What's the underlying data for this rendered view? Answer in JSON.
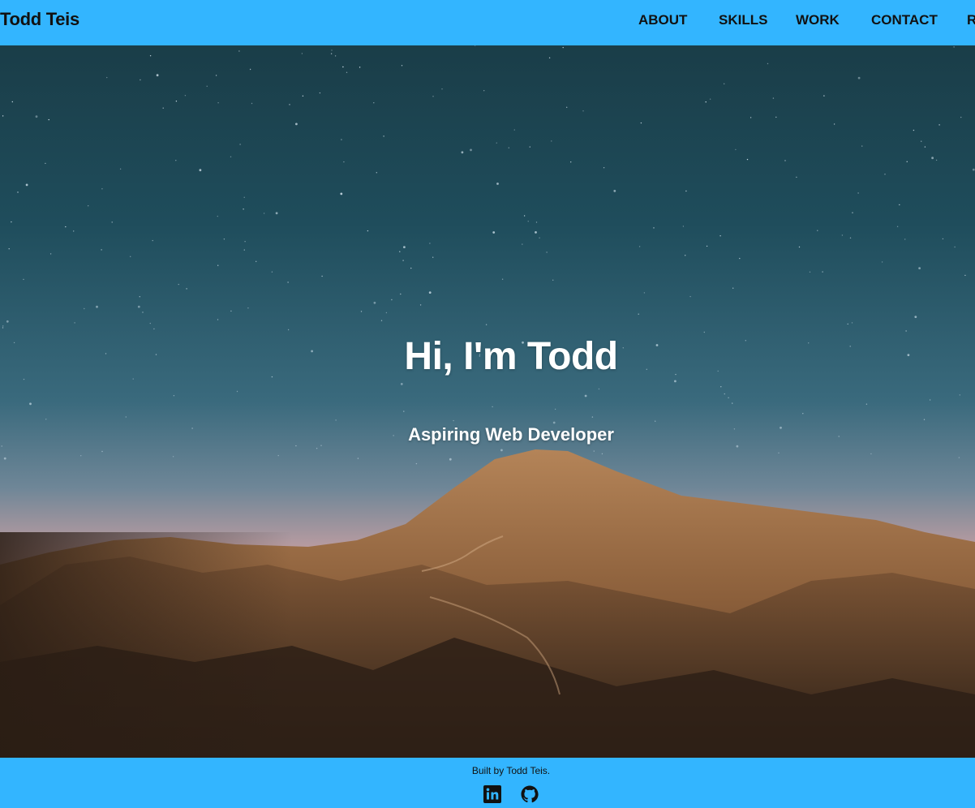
{
  "header": {
    "brand": "Todd Teis",
    "nav": [
      {
        "label": "ABOUT"
      },
      {
        "label": "SKILLS"
      },
      {
        "label": "WORK"
      },
      {
        "label": "CONTACT"
      },
      {
        "label": "R"
      }
    ]
  },
  "hero": {
    "title": "Hi, I'm Todd",
    "subtitle": "Aspiring Web Developer",
    "background": "starry-sky-desert-mountains"
  },
  "footer": {
    "credit": "Built by Todd Teis.",
    "social": [
      {
        "icon": "linkedin-icon"
      },
      {
        "icon": "github-icon"
      }
    ]
  },
  "colors": {
    "bar": "#33b5ff",
    "text": "#111111",
    "hero_text": "#ffffff"
  }
}
